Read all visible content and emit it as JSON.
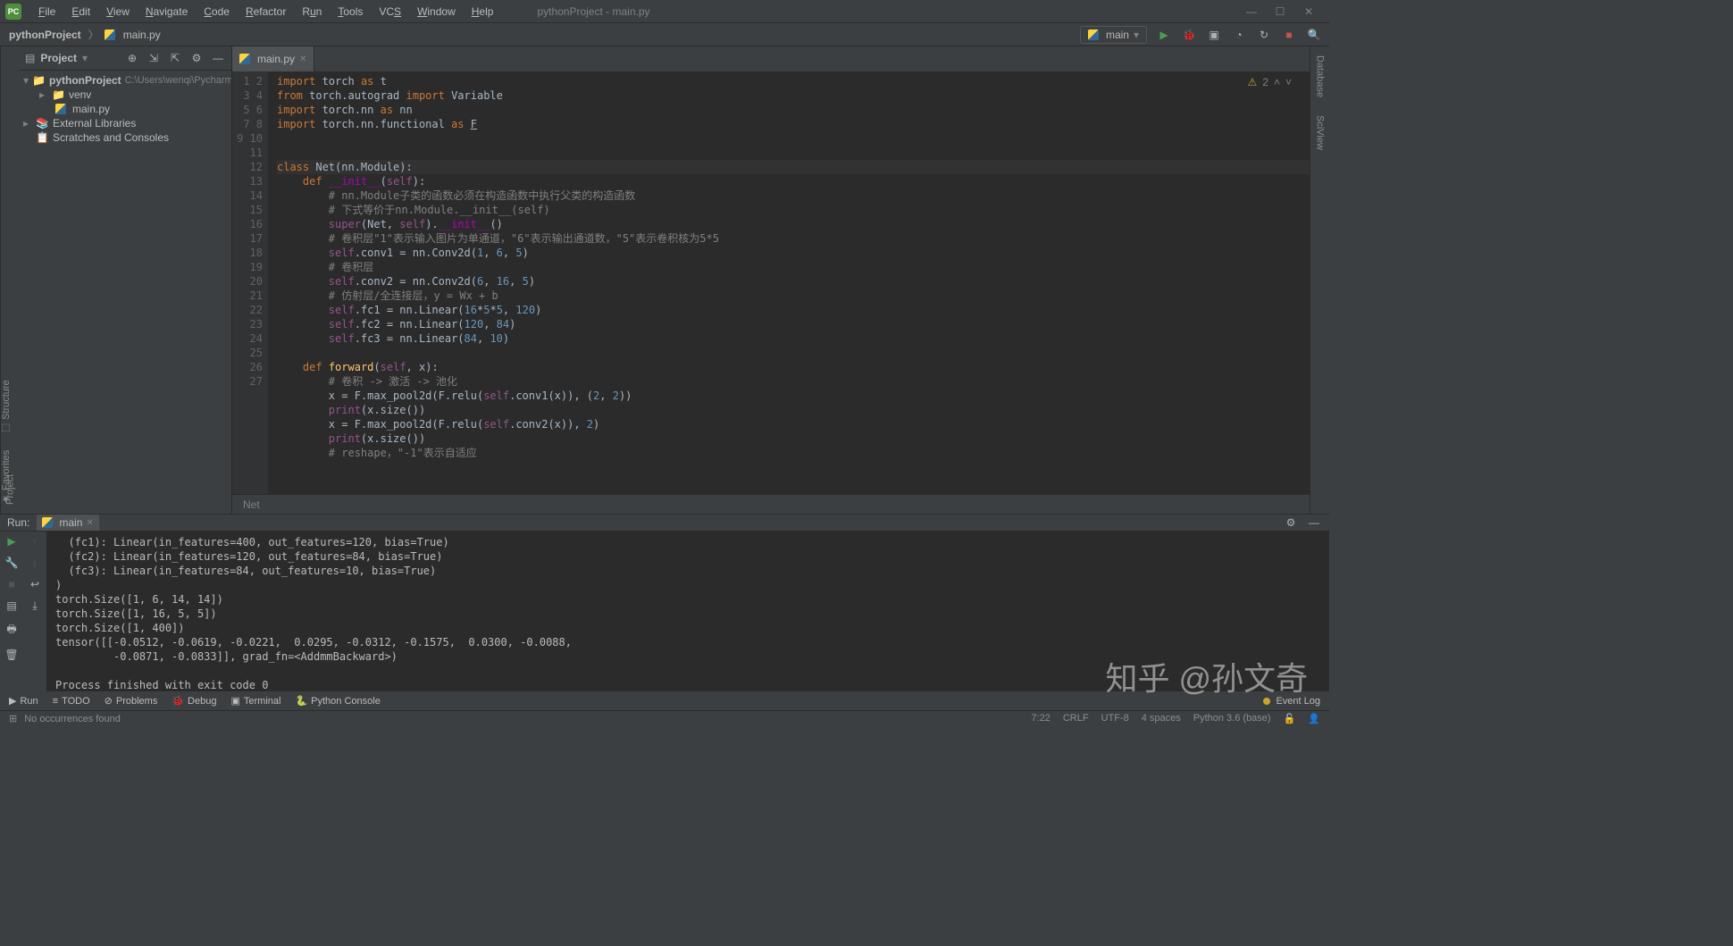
{
  "menu": [
    "File",
    "Edit",
    "View",
    "Navigate",
    "Code",
    "Refactor",
    "Run",
    "Tools",
    "VCS",
    "Window",
    "Help"
  ],
  "window_title": "pythonProject - main.py",
  "breadcrumb": {
    "project": "pythonProject",
    "file": "main.py"
  },
  "run_config": {
    "name": "main"
  },
  "project_panel": {
    "title": "Project",
    "root": "pythonProject",
    "root_hint": "C:\\Users\\wenqi\\PycharmProjects\\p",
    "venv": "venv",
    "file": "main.py",
    "ext_libs": "External Libraries",
    "scratches": "Scratches and Consoles"
  },
  "left_tabs": [
    "Project"
  ],
  "left_tabs2": [
    "Structure",
    "Favorites"
  ],
  "right_tabs": [
    "Database",
    "SciView"
  ],
  "editor": {
    "tab": "main.py",
    "warnings": "2",
    "breadcrumb_context": "Net",
    "lines": [
      1,
      2,
      3,
      4,
      5,
      6,
      7,
      8,
      9,
      10,
      11,
      12,
      13,
      14,
      15,
      16,
      17,
      18,
      19,
      20,
      21,
      22,
      23,
      24,
      25,
      26,
      27
    ]
  },
  "code_lines": {
    "1": "import torch as t",
    "2": "from torch.autograd import Variable",
    "3": "import torch.nn as nn",
    "4": "import torch.nn.functional as F",
    "7": "class Net(nn.Module):",
    "8": "    def __init__(self):",
    "9": "        # nn.Module子类的函数必须在构造函数中执行父类的构造函数",
    "10": "        # 下式等价于nn.Module.__init__(self)",
    "11": "        super(Net, self).__init__()",
    "12": "        # 卷积层\"1\"表示输入图片为单通道，\"6\"表示输出通道数，\"5\"表示卷积核为5*5",
    "13": "        self.conv1 = nn.Conv2d(1, 6, 5)",
    "14": "        # 卷积层",
    "15": "        self.conv2 = nn.Conv2d(6, 16, 5)",
    "16": "        # 仿射层/全连接层，y = Wx + b",
    "17": "        self.fc1 = nn.Linear(16*5*5, 120)",
    "18": "        self.fc2 = nn.Linear(120, 84)",
    "19": "        self.fc3 = nn.Linear(84, 10)",
    "21": "    def forward(self, x):",
    "22": "        # 卷积 -> 激活 -> 池化",
    "23": "        x = F.max_pool2d(F.relu(self.conv1(x)), (2, 2))",
    "24": "        print(x.size())",
    "25": "        x = F.max_pool2d(F.relu(self.conv2(x)), 2)",
    "26": "        print(x.size())",
    "27": "        # reshape，\"-1\"表示自适应"
  },
  "run": {
    "title": "Run:",
    "tab": "main",
    "output": "  (fc1): Linear(in_features=400, out_features=120, bias=True)\n  (fc2): Linear(in_features=120, out_features=84, bias=True)\n  (fc3): Linear(in_features=84, out_features=10, bias=True)\n)\ntorch.Size([1, 6, 14, 14])\ntorch.Size([1, 16, 5, 5])\ntorch.Size([1, 400])\ntensor([[-0.0512, -0.0619, -0.0221,  0.0295, -0.0312, -0.1575,  0.0300, -0.0088,\n         -0.0871, -0.0833]], grad_fn=<AddmmBackward>)\n\nProcess finished with exit code 0"
  },
  "bottom_tabs": {
    "run": "Run",
    "todo": "TODO",
    "problems": "Problems",
    "debug": "Debug",
    "terminal": "Terminal",
    "python_console": "Python Console",
    "event_log": "Event Log"
  },
  "status": {
    "message": "No occurrences found",
    "position": "7:22",
    "line_sep": "CRLF",
    "encoding": "UTF-8",
    "indent": "4 spaces",
    "interpreter": "Python 3.6 (base)"
  },
  "watermark": "知乎 @孙文奇"
}
